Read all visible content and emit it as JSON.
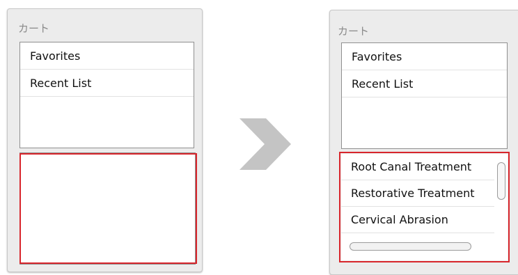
{
  "left_panel": {
    "title": "カート",
    "items": [
      {
        "label": "Favorites"
      },
      {
        "label": "Recent List"
      }
    ]
  },
  "right_panel": {
    "title": "カート",
    "items": [
      {
        "label": "Favorites"
      },
      {
        "label": "Recent List"
      }
    ],
    "treatments": [
      {
        "label": "Root Canal Treatment"
      },
      {
        "label": "Restorative Treatment"
      },
      {
        "label": "Cervical Abrasion"
      }
    ]
  },
  "colors": {
    "highlight": "#d8262c",
    "arrow": "#c4c4c4",
    "panel_bg": "#ececec"
  },
  "icons": {
    "transition": "chevron-right-icon"
  }
}
